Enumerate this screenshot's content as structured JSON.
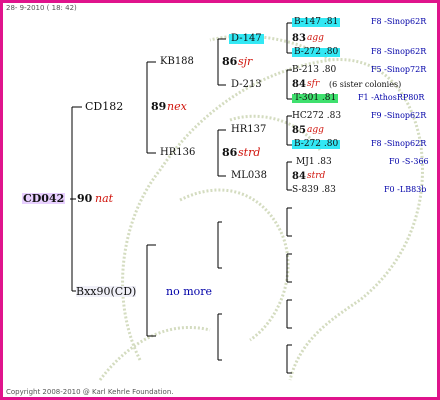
{
  "header": {
    "date": "28- 9-2010 ( 18: 42)"
  },
  "footer": {
    "copyright": "Copyright 2008-2010 @ Karl Kehrle Foundation."
  },
  "root": {
    "label": "CD042",
    "score": "90",
    "tag": "nat"
  },
  "gen1": {
    "father": {
      "label": "CD182",
      "score": "89",
      "tag": "nex"
    },
    "mother": {
      "label": "Bxx90(CD)",
      "note": "no more"
    }
  },
  "gen2": {
    "ff": {
      "label": "KB188",
      "score": "86",
      "tag": "sjr"
    },
    "fm": {
      "label": "HR136",
      "score": "86",
      "tag": "strd"
    }
  },
  "gen3": {
    "fff": {
      "label": "D-147"
    },
    "ffm": {
      "label": "D-213"
    },
    "fmf": {
      "label": "HR137"
    },
    "fmm": {
      "label": "ML038"
    }
  },
  "gen4": [
    {
      "label": "B-147 .81",
      "code": "F8 -Sinop62R"
    },
    {
      "score": "83",
      "tag": "agg"
    },
    {
      "label": "B-272 .80",
      "code": "F8 -Sinop62R"
    },
    {
      "label": "B-213 .80",
      "code": "F5 -Sinop72R"
    },
    {
      "score": "84",
      "tag": "sfr",
      "note": "(6 sister colonies)"
    },
    {
      "label": "T-301 .81",
      "code": "F1 -AthosRP80R"
    },
    {
      "label": "HC272 .83",
      "code": "F9 -Sinop62R"
    },
    {
      "score": "85",
      "tag": "agg"
    },
    {
      "label": "B-272 .80",
      "code": "F8 -Sinop62R"
    },
    {
      "label": "MJ1 .83",
      "code": "F0 -S-366"
    },
    {
      "score": "84",
      "tag": "strd"
    },
    {
      "label": "S-839 .83",
      "code": "F0 -LB83b"
    }
  ],
  "colors": {
    "border": "#e0148c",
    "highlight_cyan": "#33e8f4",
    "highlight_green": "#3fe06e",
    "root_bg": "#e8d0ff",
    "code_blue": "#0000a8",
    "tag_red": "#d0140c"
  }
}
